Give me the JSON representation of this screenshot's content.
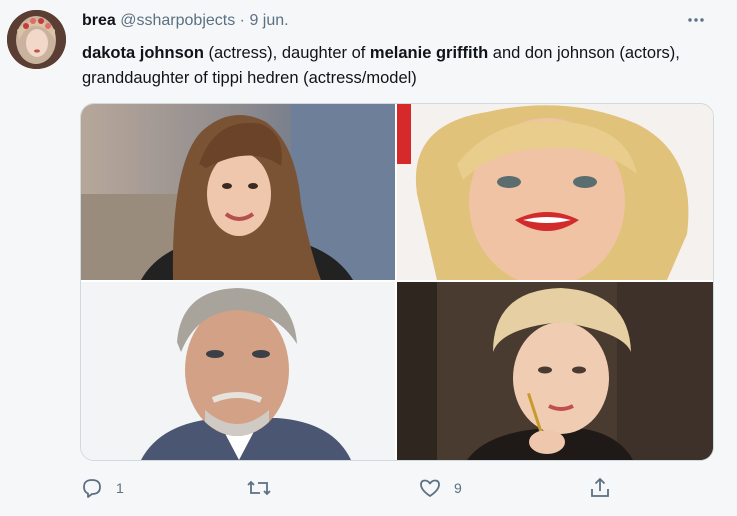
{
  "tweet": {
    "display_name": "brea",
    "handle": "@ssharpobjects",
    "separator": "·",
    "date": "9 jun.",
    "text": {
      "p1": "dakota johnson",
      "p2": " (actress), daughter of ",
      "p3": "melanie griffith",
      "p4": " and don johnson (actors), granddaughter of tippi hedren (actress/model)"
    },
    "reply_count": "1",
    "retweet_count": "",
    "like_count": "9"
  },
  "media": {
    "images": [
      {
        "name": "photo-dakota-johnson"
      },
      {
        "name": "photo-melanie-griffith"
      },
      {
        "name": "photo-don-johnson"
      },
      {
        "name": "photo-tippi-hedren"
      }
    ]
  },
  "icons": {
    "more": "more-icon",
    "reply": "reply-icon",
    "retweet": "retweet-icon",
    "like": "like-icon",
    "share": "share-icon"
  },
  "colors": {
    "background": "#f6f7f8",
    "text": "#0f1419",
    "secondary_text": "#5b7083",
    "border": "#cfd9de"
  }
}
